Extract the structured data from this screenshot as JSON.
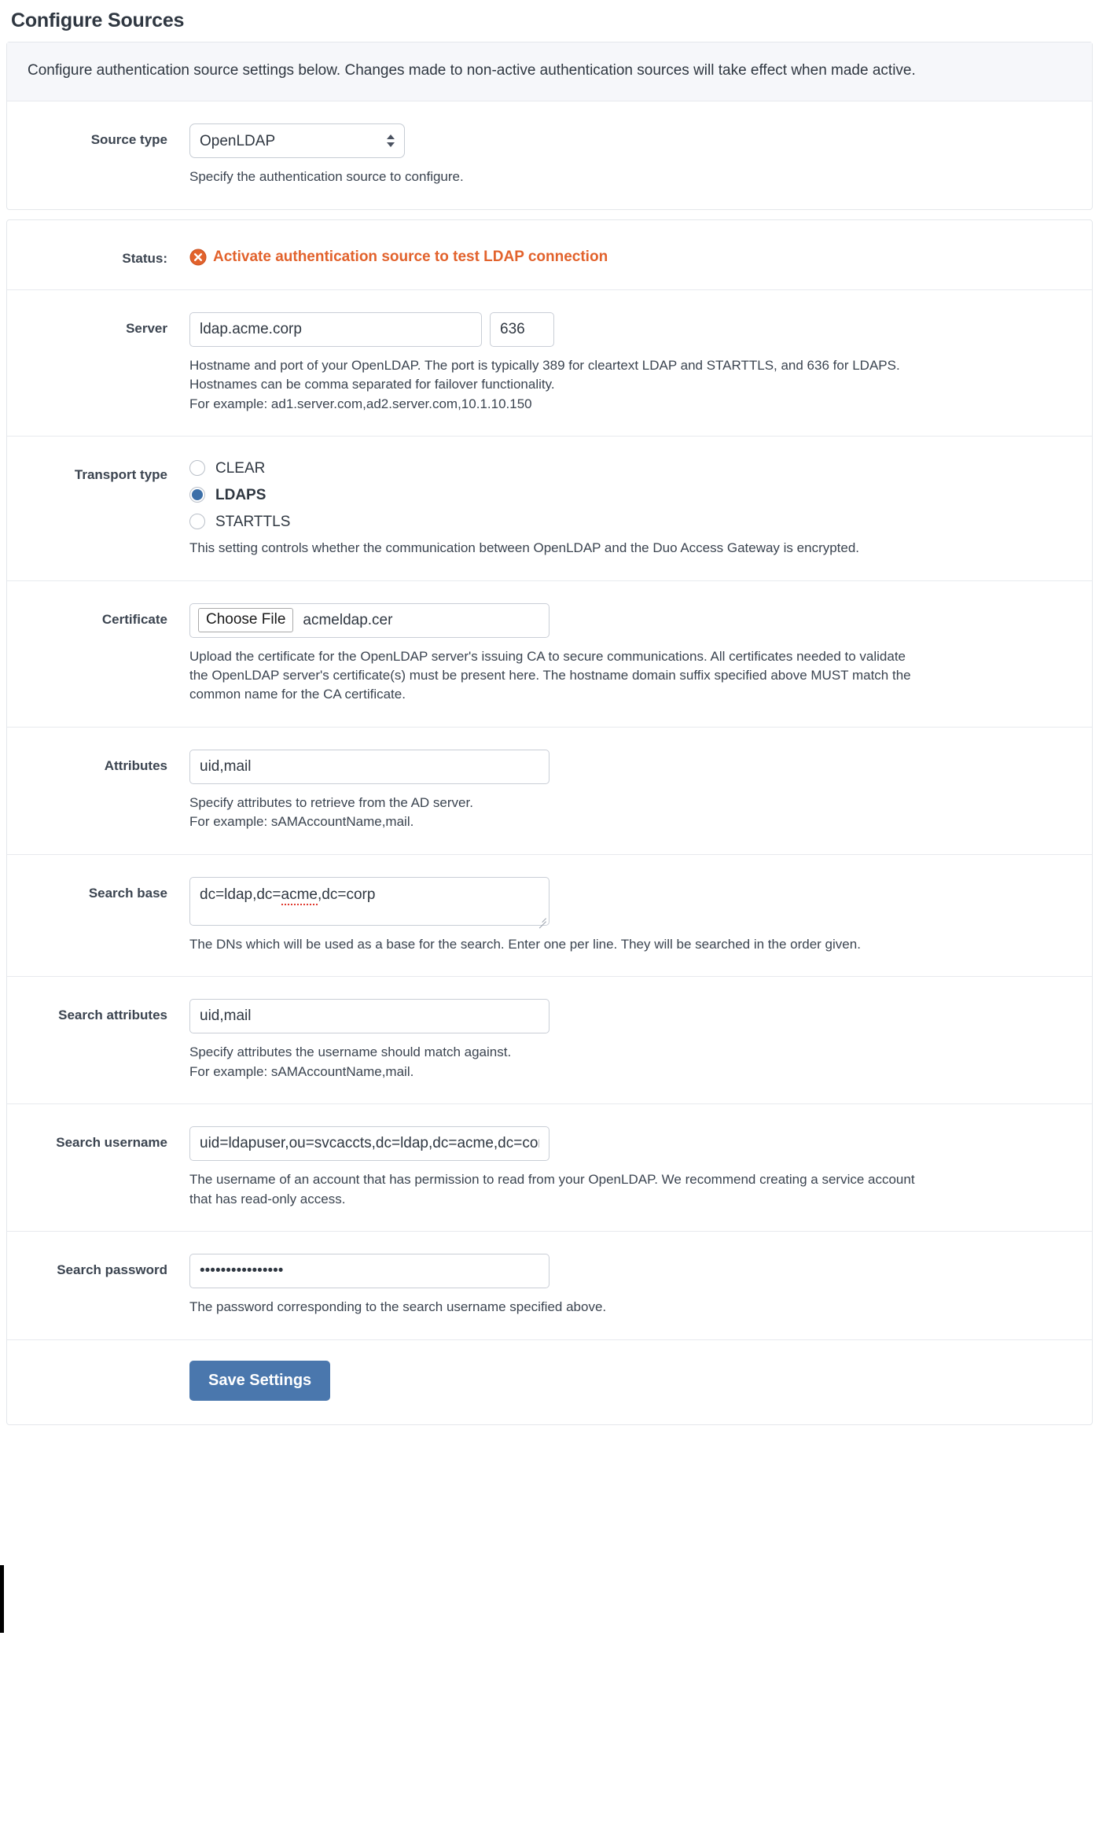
{
  "page": {
    "title": "Configure Sources",
    "note": "Configure authentication source settings below. Changes made to non-active authentication sources will take effect when made active."
  },
  "source_type": {
    "label": "Source type",
    "value": "OpenLDAP",
    "options": [
      "OpenLDAP"
    ],
    "help": "Specify the authentication source to configure."
  },
  "status": {
    "label": "Status:",
    "text": "Activate authentication source to test LDAP connection",
    "icon": "error-circle-x-icon",
    "color": "#e2622c"
  },
  "server": {
    "label": "Server",
    "host": "ldap.acme.corp",
    "port": "636",
    "help_line1": "Hostname and port of your OpenLDAP. The port is typically 389 for cleartext LDAP and STARTTLS, and 636 for LDAPS. Hostnames can be comma separated for failover functionality.",
    "help_line2": "For example: ad1.server.com,ad2.server.com,10.1.10.150"
  },
  "transport_type": {
    "label": "Transport type",
    "options": [
      {
        "label": "CLEAR",
        "selected": false
      },
      {
        "label": "LDAPS",
        "selected": true
      },
      {
        "label": "STARTTLS",
        "selected": false
      }
    ],
    "selected": "LDAPS",
    "help": "This setting controls whether the communication between OpenLDAP and the Duo Access Gateway is encrypted."
  },
  "certificate": {
    "label": "Certificate",
    "button_label": "Choose File",
    "file_name": "acmeldap.cer",
    "help": "Upload the certificate for the OpenLDAP server's issuing CA to secure communications. All certificates needed to validate the OpenLDAP server's certificate(s) must be present here. The hostname domain suffix specified above MUST match the common name for the CA certificate."
  },
  "attributes": {
    "label": "Attributes",
    "value": "uid,mail",
    "help_line1": "Specify attributes to retrieve from the AD server.",
    "help_line2": "For example: sAMAccountName,mail."
  },
  "search_base": {
    "label": "Search base",
    "value": "dc=ldap,dc=acme,dc=corp",
    "value_prefix": "dc=ldap,dc=",
    "value_misspelled": "acme",
    "value_suffix": ",dc=corp",
    "help": "The DNs which will be used as a base for the search. Enter one per line. They will be searched in the order given."
  },
  "search_attributes": {
    "label": "Search attributes",
    "value": "uid,mail",
    "help_line1": "Specify attributes the username should match against.",
    "help_line2": "For example: sAMAccountName,mail."
  },
  "search_username": {
    "label": "Search username",
    "value": "uid=ldapuser,ou=svcaccts,dc=ldap,dc=acme,dc=corp",
    "help": "The username of an account that has permission to read from your OpenLDAP. We recommend creating a service account that has read-only access."
  },
  "search_password": {
    "label": "Search password",
    "value": "••••••••••••••••",
    "help": "The password corresponding to the search username specified above."
  },
  "actions": {
    "save_label": "Save Settings",
    "save_color": "#4a77ad"
  }
}
